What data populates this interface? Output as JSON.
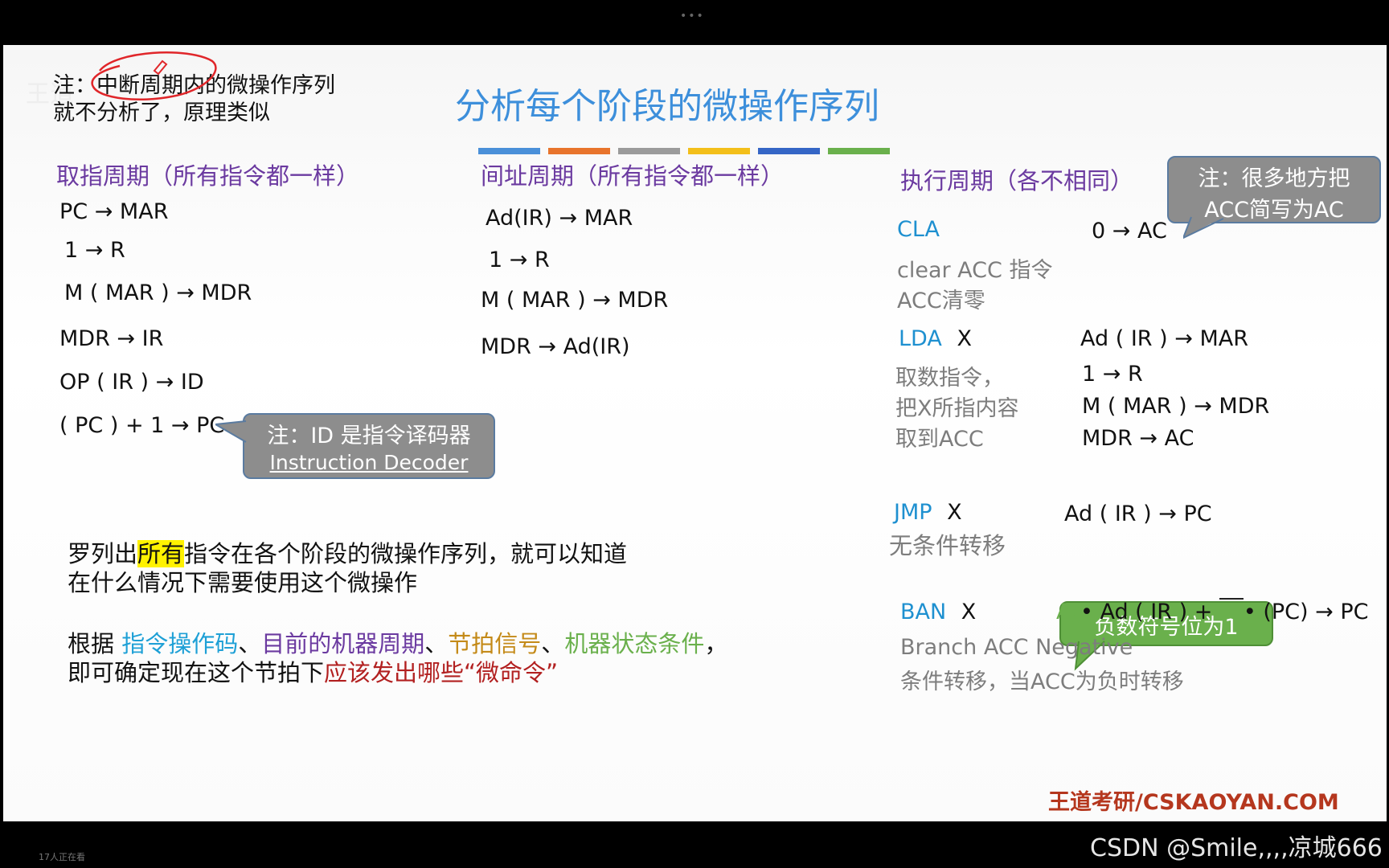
{
  "top_dots": "•••",
  "watermark_bg": "王道",
  "note_top": {
    "line1": "注：中断周期内的微操作序列",
    "line2": "就不分析了，原理类似"
  },
  "title": "分析每个阶段的微操作序列",
  "color_bars": [
    "#4a90d9",
    "#e8742c",
    "#9b9b9b",
    "#f3bf1a",
    "#3566c6",
    "#6ab04c"
  ],
  "fetch": {
    "heading": "取指周期（所有指令都一样）",
    "ops": [
      "PC → MAR",
      "1 → R",
      "M ( MAR ) → MDR",
      "MDR → IR",
      "OP ( IR ) → ID",
      "( PC ) + 1 → PC"
    ]
  },
  "indirect": {
    "heading": "间址周期（所有指令都一样）",
    "ops": [
      "Ad(IR) → MAR",
      "1 → R",
      "M ( MAR ) → MDR",
      "MDR → Ad(IR)"
    ]
  },
  "execute": {
    "heading": "执行周期（各不相同）",
    "cla": {
      "name": "CLA",
      "desc1": "clear ACC 指令",
      "desc2": "ACC清零",
      "op": "0 → AC"
    },
    "lda": {
      "name": "LDA",
      "arg": "X",
      "desc1": "取数指令，",
      "desc2": "把X所指内容",
      "desc3": "取到ACC",
      "ops": [
        "Ad ( IR ) → MAR",
        "1 → R",
        "M ( MAR ) → MDR",
        "MDR → AC"
      ]
    },
    "jmp": {
      "name": "JMP",
      "arg": "X",
      "desc": "无条件转移",
      "op": "Ad ( IR ) → PC"
    },
    "ban": {
      "name": "BAN",
      "arg": "X",
      "desc1": "Branch ACC Negative",
      "desc2": "条件转移，当ACC为负时转移",
      "a0": "A",
      "sub0": "0",
      "op_mid": "• Ad ( IR ) + ",
      "op_end": "• (PC) → PC"
    }
  },
  "callout_id": {
    "line1": "注：ID 是指令译码器",
    "line2": "Instruction Decoder"
  },
  "callout_acc": {
    "line1": "注：很多地方把",
    "line2": "ACC简写为AC"
  },
  "callout_neg": {
    "text": "负数符号位为1"
  },
  "bottom_text": {
    "p1_a": "罗列出",
    "p1_hl": "所有",
    "p1_b": "指令在各个阶段的微操作序列，就可以知道",
    "p1_c": "在什么情况下需要使用这个微操作",
    "p2_a": "根据 ",
    "p2_opcode": "指令操作码",
    "p2_sep1": "、",
    "p2_cycle": "目前的机器周期",
    "p2_sep2": "、",
    "p2_beat": "节拍信号",
    "p2_sep3": "、",
    "p2_state": "机器状态条件",
    "p2_end": "，",
    "p3_a": "即可确定现在这个节拍下",
    "p3_red": "应该发出哪些“微命令”"
  },
  "brand": "王道考研/CSKAOYAN.COM",
  "csdn": "CSDN @Smile,,,,凉城666",
  "bottom_left_small": "17人正在看"
}
